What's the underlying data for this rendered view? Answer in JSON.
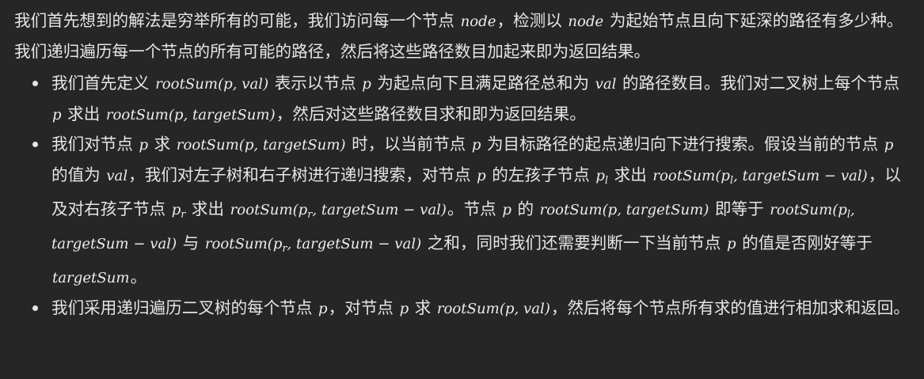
{
  "intro": {
    "t1": "我们首先想到的解法是穷举所有的可能，我们访问每一个节点 ",
    "m1": "node",
    "t2": "，检测以 ",
    "m2": "node",
    "t3": " 为起始节点且向下延深的路径有多少种。我们递归遍历每一个节点的所有可能的路径，然后将这些路径数目加起来即为返回结果。"
  },
  "bullets": [
    {
      "t1": "我们首先定义 ",
      "m1": "rootSum(p, val)",
      "t2": " 表示以节点 ",
      "m2": "p",
      "t3": " 为起点向下且满足路径总和为 ",
      "m3": "val",
      "t4": " 的路径数目。我们对二叉树上每个节点 ",
      "m4": "p",
      "t5": " 求出 ",
      "m5": "rootSum(p, targetSum)",
      "t6": "，然后对这些路径数目求和即为返回结果。"
    },
    {
      "t1": "我们对节点 ",
      "m1": "p",
      "t2": " 求 ",
      "m2": "rootSum(p, targetSum)",
      "t3": " 时，以当前节点 ",
      "m3": "p",
      "t4": " 为目标路径的起点递归向下进行搜索。假设当前的节点 ",
      "m4": "p",
      "t5": " 的值为 ",
      "m5": "val",
      "t6": "，我们对左子树和右子树进行递归搜索，对节点 ",
      "m6": "p",
      "t7": " 的左孩子节点 ",
      "m7_base": "p",
      "m7_sub": "l",
      "t8": " 求出 ",
      "m8_a": "rootSum(p",
      "m8_sub": "l",
      "m8_b": ", targetSum − val)",
      "t9": "，以及对右孩子节点 ",
      "m9_base": "p",
      "m9_sub": "r",
      "t10": " 求出 ",
      "m10_a": "rootSum(p",
      "m10_sub": "r",
      "m10_b": ", targetSum − val)",
      "t11": "。节点 ",
      "m11": "p",
      "t12": " 的 ",
      "m12": "rootSum(p, targetSum)",
      "t13": " 即等于 ",
      "m13_a": "rootSum(p",
      "m13_sub": "l",
      "m13_b": ", targetSum − val)",
      "t14": " 与 ",
      "m14_a": "rootSum(p",
      "m14_sub": "r",
      "m14_b": ", targetSum − val)",
      "t15": " 之和，同时我们还需要判断一下当前节点 ",
      "m15": "p",
      "t16": " 的值是否刚好等于 ",
      "m16": "targetSum",
      "t17": "。"
    },
    {
      "t1": "我们采用递归遍历二叉树的每个节点 ",
      "m1": "p",
      "t2": "，对节点 ",
      "m2": "p",
      "t3": " 求 ",
      "m3": "rootSum(p, val)",
      "t4": "，然后将每个节点所有求的值进行相加求和返回。"
    }
  ]
}
